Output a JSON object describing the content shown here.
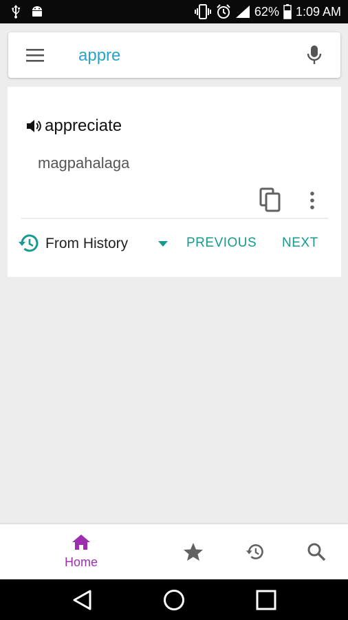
{
  "status_bar": {
    "battery_percent": "62%",
    "time": "1:09 AM",
    "icons": [
      "usb-icon",
      "android-icon",
      "vibrate-icon",
      "alarm-icon",
      "signal-icon",
      "battery-icon"
    ]
  },
  "search": {
    "query": "appre",
    "icons": [
      "menu-icon",
      "mic-icon"
    ]
  },
  "result": {
    "word": "appreciate",
    "translation": "magpahalaga",
    "icons": [
      "speaker-icon",
      "copy-icon",
      "more-vert-icon"
    ]
  },
  "history_nav": {
    "source_label": "From History",
    "previous_label": "PREVIOUS",
    "next_label": "NEXT"
  },
  "bottom_nav": {
    "home_label": "Home",
    "items": [
      "home-icon",
      "star-icon",
      "history-icon",
      "search-icon"
    ]
  },
  "colors": {
    "accent_teal": "#16998f",
    "query_blue": "#29a3c9",
    "active_purple": "#9b2fae",
    "icon_gray": "#616161"
  }
}
